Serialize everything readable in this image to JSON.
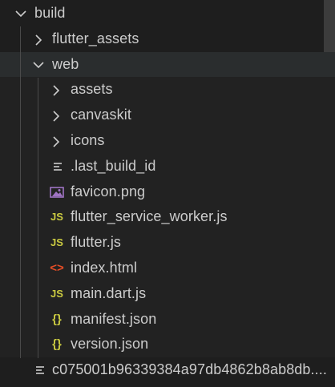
{
  "explorer": {
    "items": [
      {
        "label": "build",
        "type": "folder",
        "expanded": true,
        "depth": 0,
        "icon": "chevron-down-icon"
      },
      {
        "label": "flutter_assets",
        "type": "folder",
        "expanded": false,
        "depth": 1,
        "icon": "chevron-right-icon"
      },
      {
        "label": "web",
        "type": "folder",
        "expanded": true,
        "depth": 1,
        "icon": "chevron-down-icon"
      },
      {
        "label": "assets",
        "type": "folder",
        "expanded": false,
        "depth": 2,
        "icon": "chevron-right-icon"
      },
      {
        "label": "canvaskit",
        "type": "folder",
        "expanded": false,
        "depth": 2,
        "icon": "chevron-right-icon"
      },
      {
        "label": "icons",
        "type": "folder",
        "expanded": false,
        "depth": 2,
        "icon": "chevron-right-icon"
      },
      {
        "label": ".last_build_id",
        "type": "file",
        "depth": 2,
        "icon": "text-file-icon"
      },
      {
        "label": "favicon.png",
        "type": "file",
        "depth": 2,
        "icon": "image-file-icon"
      },
      {
        "label": "flutter_service_worker.js",
        "type": "file",
        "depth": 2,
        "icon": "js-file-icon",
        "badge": "JS"
      },
      {
        "label": "flutter.js",
        "type": "file",
        "depth": 2,
        "icon": "js-file-icon",
        "badge": "JS"
      },
      {
        "label": "index.html",
        "type": "file",
        "depth": 2,
        "icon": "html-file-icon",
        "badge": "<>"
      },
      {
        "label": "main.dart.js",
        "type": "file",
        "depth": 2,
        "icon": "js-file-icon",
        "badge": "JS"
      },
      {
        "label": "manifest.json",
        "type": "file",
        "depth": 2,
        "icon": "json-file-icon",
        "badge": "{}"
      },
      {
        "label": "version.json",
        "type": "file",
        "depth": 2,
        "icon": "json-file-icon",
        "badge": "{}"
      },
      {
        "label": "c075001b96339384a97db4862b8ab8db....",
        "type": "file",
        "depth": 1,
        "icon": "text-file-icon"
      }
    ]
  },
  "colors": {
    "background": "#1e1e1e",
    "text": "#cccccc",
    "js_badge": "#cbcb41",
    "json_badge": "#cbcb41",
    "html_badge": "#e44d26",
    "image_icon": "#a074c4",
    "text_icon": "#cccccc",
    "selected_row": "#2a2d2e"
  }
}
